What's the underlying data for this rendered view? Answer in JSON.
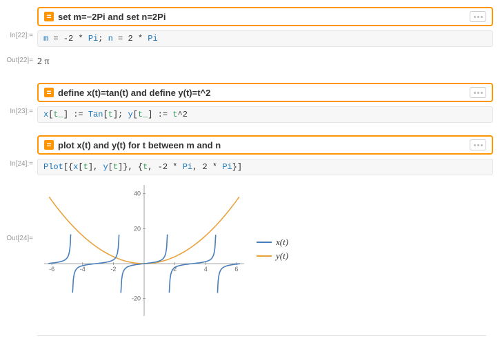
{
  "cells": {
    "c1": {
      "in_label": "In[22]:=",
      "out_label": "Out[22]=",
      "nl_query": "set m=−2Pi and set n=2Pi",
      "out_value": "2 π"
    },
    "c2": {
      "in_label": "In[23]:=",
      "nl_query": "define x(t)=tan(t) and define y(t)=t^2"
    },
    "c3": {
      "in_label": "In[24]:=",
      "out_label": "Out[24]=",
      "nl_query": "plot x(t) and y(t) for t between m and n"
    }
  },
  "code": {
    "c1_tokens": [
      "m",
      " = ",
      "-",
      "2",
      " * ",
      "Pi",
      "; ",
      "n",
      " = ",
      "2",
      " * ",
      "Pi"
    ],
    "c2_raw": "x[t_] := Tan[t]; y[t_] := t^2",
    "c3_raw": "Plot[{x[t], y[t]}, {t, -2 * Pi, 2 * Pi}]"
  },
  "legend": {
    "series1": "x(t)",
    "series2": "y(t)",
    "color1": "#4a7ebb",
    "color2": "#e8a33d"
  },
  "chart_data": {
    "type": "line",
    "title": "",
    "xlabel": "",
    "ylabel": "",
    "xlim": [
      -6.5,
      6.5
    ],
    "ylim": [
      -30,
      45
    ],
    "x_ticks": [
      -6,
      -4,
      -2,
      2,
      4,
      6
    ],
    "y_ticks": [
      -20,
      20,
      40
    ],
    "series": [
      {
        "name": "x(t)",
        "color": "#4a7ebb",
        "function": "tan(t)",
        "asymptotes": [
          -4.712,
          -1.571,
          1.571,
          4.712
        ],
        "domain": [
          -6.283,
          6.283
        ]
      },
      {
        "name": "y(t)",
        "color": "#e8a33d",
        "function": "t^2",
        "sample": [
          [
            -6.28,
            39.5
          ],
          [
            -5,
            25
          ],
          [
            -4,
            16
          ],
          [
            -3,
            9
          ],
          [
            -2,
            4
          ],
          [
            -1,
            1
          ],
          [
            0,
            0
          ],
          [
            1,
            1
          ],
          [
            2,
            4
          ],
          [
            3,
            9
          ],
          [
            4,
            16
          ],
          [
            5,
            25
          ],
          [
            6.28,
            39.5
          ]
        ]
      }
    ]
  }
}
